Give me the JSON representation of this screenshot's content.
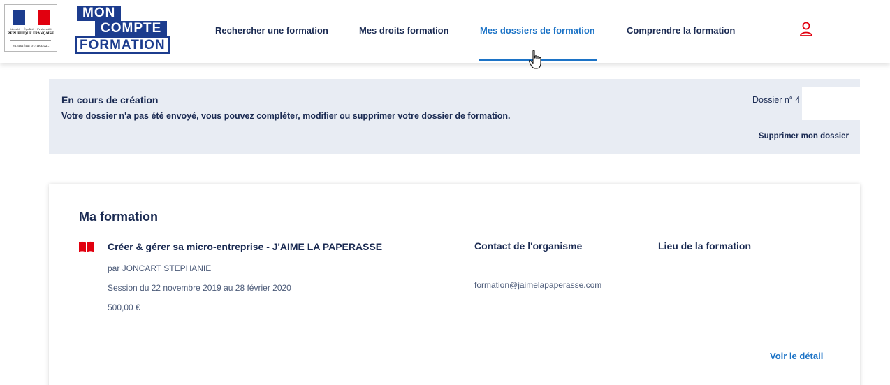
{
  "header": {
    "ministry_logo": {
      "motto": "Liberté • Égalité • Fraternité",
      "republic": "RÉPUBLIQUE FRANÇAISE",
      "ministry": "MINISTÈRE DU TRAVAIL"
    },
    "brand": {
      "line1": "MON",
      "line2": "COMPTE",
      "line3": "FORMATION"
    },
    "nav": [
      {
        "label": "Rechercher une formation",
        "active": false
      },
      {
        "label": "Mes droits formation",
        "active": false
      },
      {
        "label": "Mes dossiers de formation",
        "active": true
      },
      {
        "label": "Comprendre la formation",
        "active": false
      }
    ],
    "user_icon": "user-icon"
  },
  "status": {
    "title": "En cours de création",
    "message": "Votre dossier n'a pas été envoyé, vous pouvez compléter, modifier ou supprimer votre dossier de formation.",
    "dossier_number": "Dossier n° 4",
    "delete_label": "Supprimer mon dossier"
  },
  "formation": {
    "section_title": "Ma formation",
    "icon": "book-icon",
    "title": "Créer & gérer sa micro-entreprise - J'AIME LA PAPERASSE",
    "by": "par JONCART STEPHANIE",
    "session": "Session du 22 novembre 2019 au 28 février 2020",
    "price": "500,00 €",
    "contact_heading": "Contact de l'organisme",
    "contact_email": "formation@jaimelapaperasse.com",
    "location_heading": "Lieu de la formation",
    "detail_label": "Voir le détail"
  },
  "colors": {
    "navy": "#1a2a52",
    "accent_blue": "#1c73c6",
    "brand_blue": "#1c3c8e",
    "icon_red": "#e1000f",
    "banner_bg": "#e8ecf3"
  }
}
